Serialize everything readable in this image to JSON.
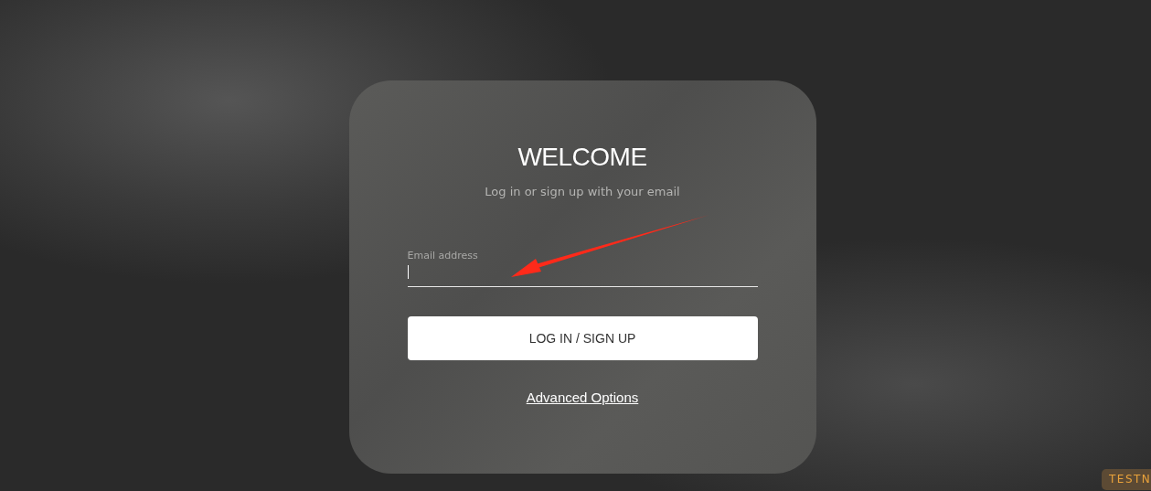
{
  "card": {
    "title": "WELCOME",
    "subtitle": "Log in or sign up with your email",
    "email_field": {
      "label": "Email address",
      "focused": true
    },
    "submit_button": {
      "label": "LOG IN / SIGN UP"
    },
    "link": {
      "label": "Advanced Options"
    }
  },
  "annotation": {
    "kind": "arrow"
  },
  "badge": {
    "label": "TESTN"
  }
}
